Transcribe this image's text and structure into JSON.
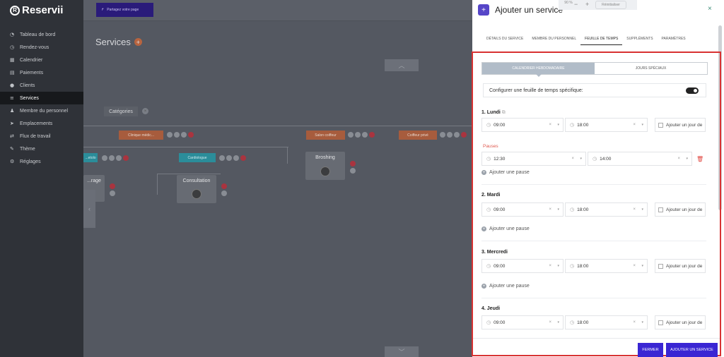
{
  "app": {
    "logo_text": "Reservii"
  },
  "sidebar": {
    "items": [
      {
        "label": "Tableau de bord",
        "icon": "gauge-icon",
        "glyph": "◔"
      },
      {
        "label": "Rendez-vous",
        "icon": "clock-icon",
        "glyph": "◷"
      },
      {
        "label": "Calendrier",
        "icon": "calendar-icon",
        "glyph": "▦"
      },
      {
        "label": "Paiements",
        "icon": "payment-icon",
        "glyph": "▤"
      },
      {
        "label": "Clients",
        "icon": "users-icon",
        "glyph": "●"
      },
      {
        "label": "Services",
        "icon": "services-icon",
        "glyph": "≡",
        "active": true
      },
      {
        "label": "Membre du personnel",
        "icon": "user-icon",
        "glyph": "♟"
      },
      {
        "label": "Emplacements",
        "icon": "location-icon",
        "glyph": "➤"
      },
      {
        "label": "Flux de travail",
        "icon": "workflow-icon",
        "glyph": "⇄"
      },
      {
        "label": "Thème",
        "icon": "brush-icon",
        "glyph": "✎"
      },
      {
        "label": "Réglages",
        "icon": "settings-icon",
        "glyph": "⚙"
      }
    ]
  },
  "topbar": {
    "share_label": "Partagez votre page",
    "share_glyph": "↱"
  },
  "zoom": {
    "value": "90 %",
    "minus": "−",
    "plus": "+",
    "reset_label": "Réinitialiser"
  },
  "main": {
    "title": "Services",
    "add_glyph": "+",
    "up_glyph": "︿",
    "down_glyph": "﹀",
    "collapse_glyph": "‹",
    "categories_label": "Catégories",
    "categories_clear": "×",
    "tree": {
      "cat1": "Clinique médic...",
      "cat2": "Salon coiffeur",
      "cat3": "Coiffeur privé",
      "sub1": "...etolo",
      "sub2": "Cardiologue",
      "card1": "...rage",
      "card2": "Consultation",
      "card3": "Broshing"
    }
  },
  "panel": {
    "plus_glyph": "+",
    "title": "Ajouter un service",
    "close_glyph": "×",
    "tabs": [
      {
        "label": "Détails du service"
      },
      {
        "label": "Membre du personnel"
      },
      {
        "label": "Feuille de temps",
        "active": true
      },
      {
        "label": "Suppléments"
      },
      {
        "label": "Paramètres"
      }
    ],
    "subtabs": [
      "Calendrier hebdomadaire",
      "Jours spéciaux"
    ],
    "config_label": "Configurer une feuille de temps spécifique:",
    "clock_glyph": "◷",
    "clear_glyph": "×",
    "caret_glyph": "▾",
    "add_pause_glyph": "+",
    "trash_glyph": "🗑",
    "extra_day_label": "Ajouter un jour de",
    "pauses_label": "Pauses",
    "add_pause_label": "Ajouter une pause",
    "days": [
      {
        "label": "1. Lundi",
        "start": "09:00",
        "end": "18:00",
        "pause_start": "12:30",
        "pause_end": "14:00",
        "copy_glyph": "⧉"
      },
      {
        "label": "2. Mardi",
        "start": "09:00",
        "end": "18:00"
      },
      {
        "label": "3. Mercredi",
        "start": "09:00",
        "end": "18:00"
      },
      {
        "label": "4. Jeudi",
        "start": "09:00",
        "end": "18:00"
      }
    ],
    "footer": {
      "close_label": "Fermer",
      "add_label": "Ajouter un service"
    }
  }
}
